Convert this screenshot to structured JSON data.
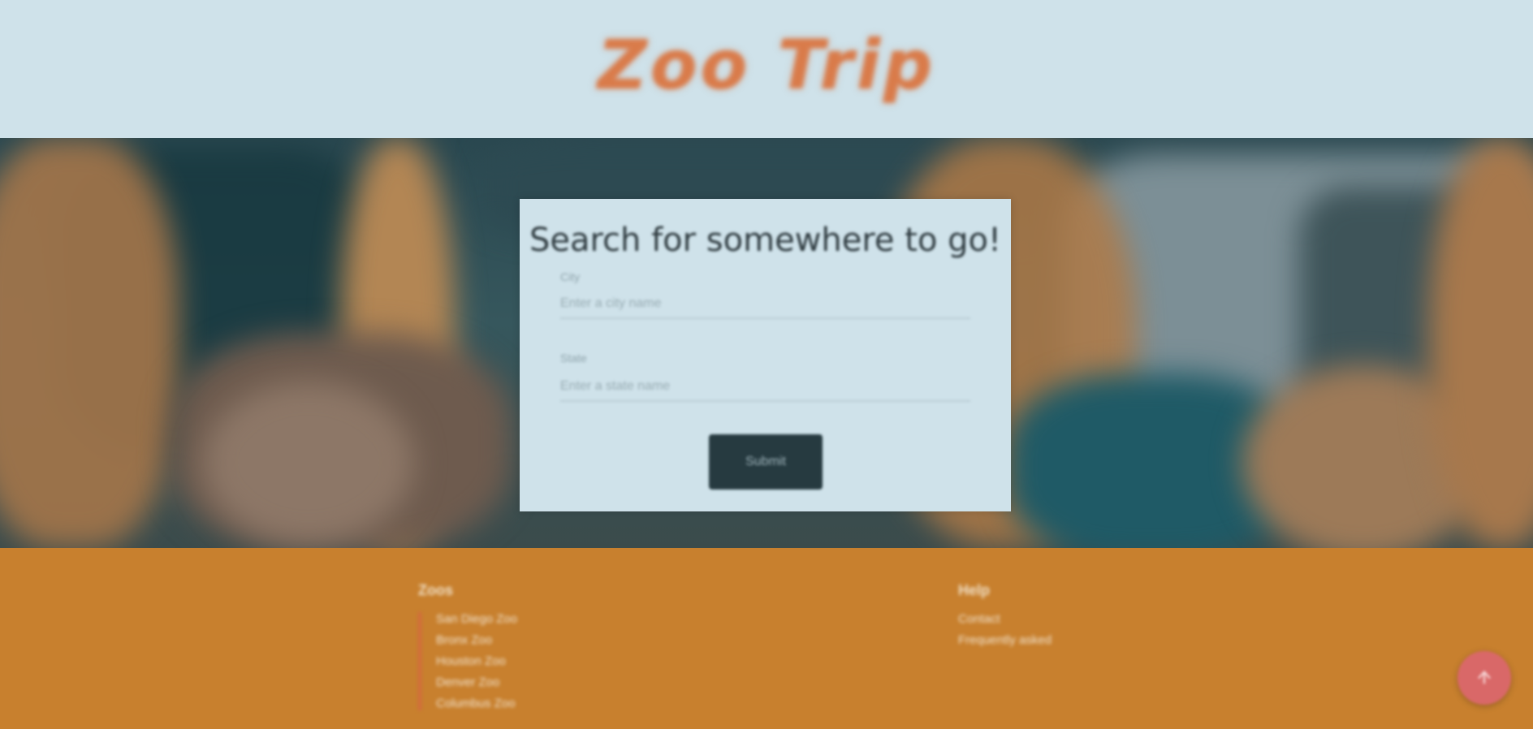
{
  "header": {
    "logo_text": "Zoo Trip"
  },
  "search": {
    "title": "Search for somewhere to go!",
    "fields": [
      {
        "label": "City",
        "placeholder": "Enter a city name"
      },
      {
        "label": "State",
        "placeholder": "Enter a state name"
      }
    ],
    "submit_label": "Submit"
  },
  "footer": {
    "left": {
      "heading": "Zoos",
      "links": [
        "San Diego Zoo",
        "Bronx Zoo",
        "Houston Zoo",
        "Denver Zoo",
        "Columbus Zoo"
      ]
    },
    "right": {
      "heading": "Help",
      "links": [
        "Contact",
        "Frequently asked"
      ]
    }
  },
  "colors": {
    "header_bg": "#cfe2ea",
    "logo": "#d97b4a",
    "footer_bg": "#c8802e",
    "button_bg": "#263a40",
    "fab": "#d96868"
  },
  "icons": {
    "fab": "arrow-up-icon"
  }
}
